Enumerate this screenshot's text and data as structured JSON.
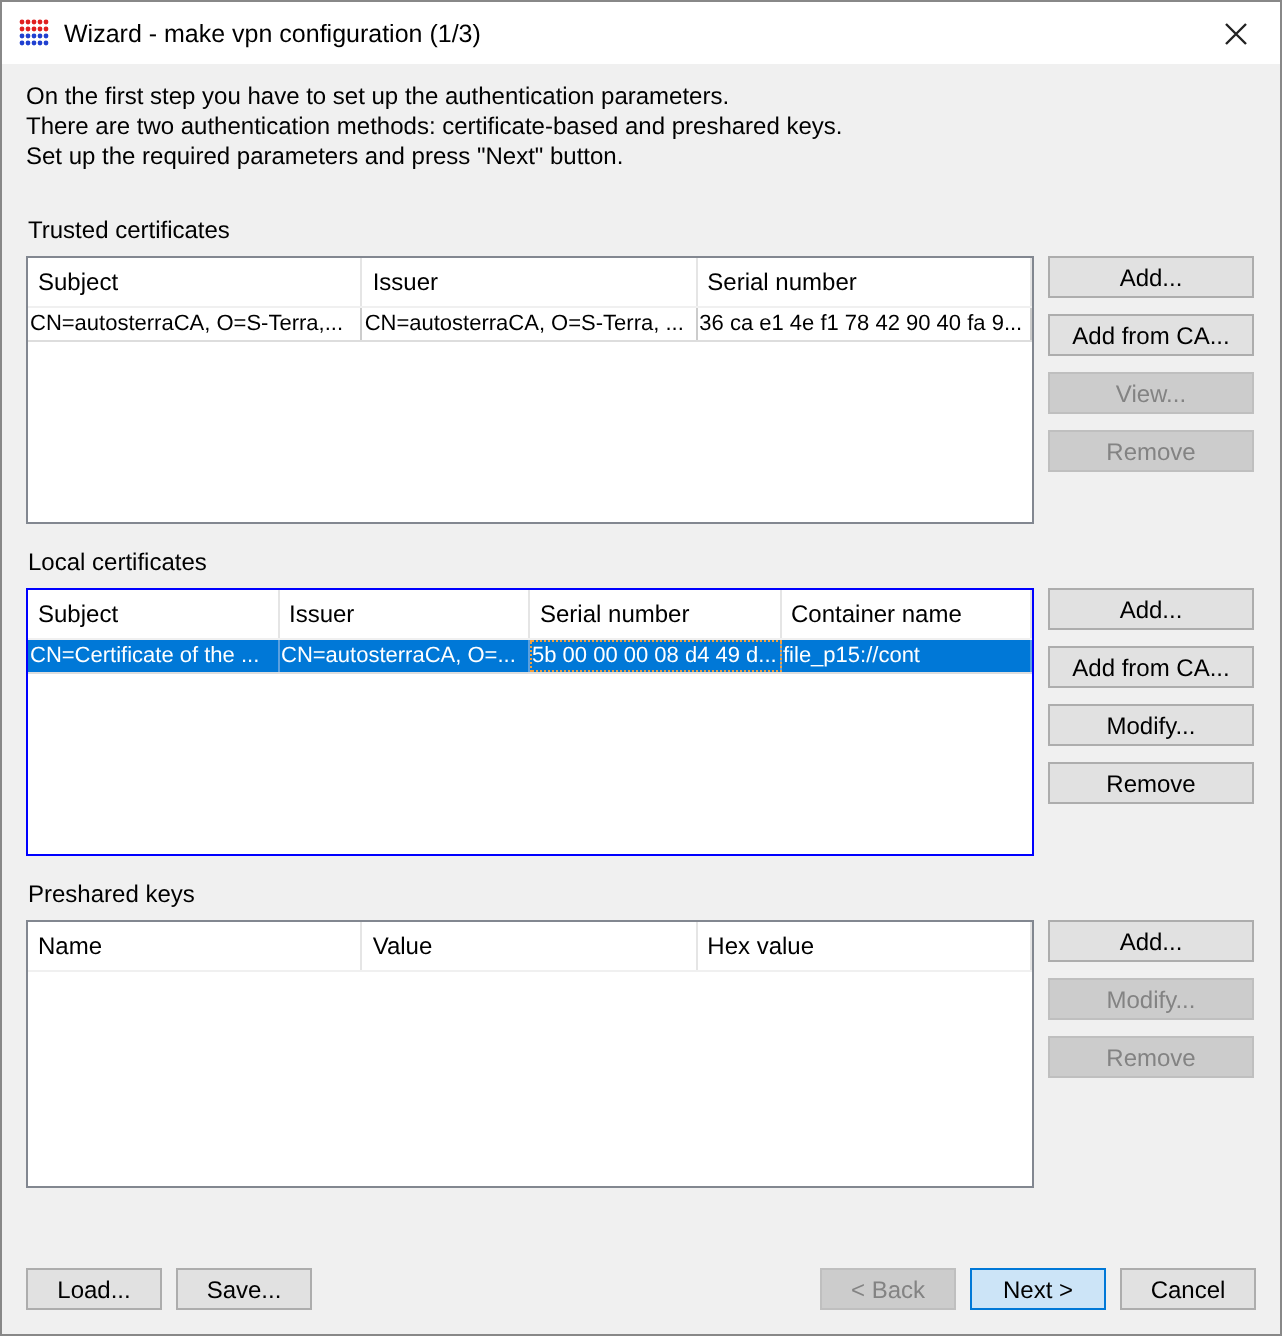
{
  "window": {
    "title": "Wizard - make vpn configuration (1/3)"
  },
  "intro": [
    "On the first step you have to set up the authentication parameters.",
    "There are two authentication methods: certificate-based and preshared keys.",
    "Set up the required parameters and press \"Next\" button."
  ],
  "sections": [
    {
      "label": "Trusted certificates",
      "focused": false,
      "columns": [
        "Subject",
        "Issuer",
        "Serial number"
      ],
      "rows": [
        {
          "selected": false,
          "cells": [
            "CN=autosterraCA, O=S-Terra,...",
            "CN=autosterraCA, O=S-Terra, ...",
            "36 ca e1 4e f1 78 42 90 40 fa 9..."
          ]
        }
      ],
      "buttons": [
        {
          "label": "Add...",
          "disabled": false
        },
        {
          "label": "Add from CA...",
          "disabled": false
        },
        {
          "label": "View...",
          "disabled": true
        },
        {
          "label": "Remove",
          "disabled": true
        }
      ]
    },
    {
      "label": "Local certificates",
      "focused": true,
      "columns": [
        "Subject",
        "Issuer",
        "Serial number",
        "Container name"
      ],
      "rows": [
        {
          "selected": true,
          "cells": [
            "CN=Certificate of the ...",
            "CN=autosterraCA, O=...",
            "5b 00 00 00 08 d4 49 d...",
            "file_p15://cont"
          ]
        }
      ],
      "buttons": [
        {
          "label": "Add...",
          "disabled": false
        },
        {
          "label": "Add from CA...",
          "disabled": false
        },
        {
          "label": "Modify...",
          "disabled": false
        },
        {
          "label": "Remove",
          "disabled": false
        }
      ]
    },
    {
      "label": "Preshared keys",
      "focused": false,
      "columns": [
        "Name",
        "Value",
        "Hex value"
      ],
      "buttons": [
        {
          "label": "Add...",
          "disabled": false
        },
        {
          "label": "Modify...",
          "disabled": true
        },
        {
          "label": "Remove",
          "disabled": true
        }
      ]
    }
  ],
  "footer_left": [
    {
      "label": "Load...",
      "disabled": false,
      "default": false
    },
    {
      "label": "Save...",
      "disabled": false,
      "default": false
    }
  ],
  "footer_right": [
    {
      "label": "< Back",
      "disabled": true,
      "default": false
    },
    {
      "label": "Next >",
      "disabled": false,
      "default": true
    },
    {
      "label": "Cancel",
      "disabled": false,
      "default": false
    }
  ]
}
